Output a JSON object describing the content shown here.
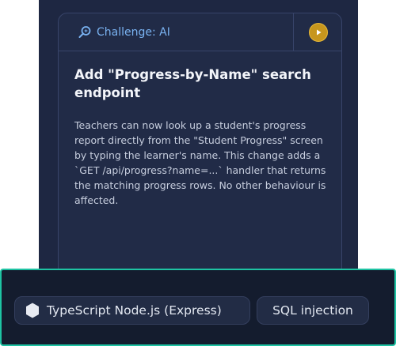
{
  "challenge": {
    "label": "Challenge: AI",
    "icon": "magnifier-sparkle-icon",
    "play_icon": "play-icon",
    "title": "Add \"Progress-by-Name\" search endpoint",
    "description": "Teachers can now look up a student's progress report directly from the \"Student Progress\" screen by typing the learner's name. This change adds a `GET /api/progress?name=...` handler that returns the matching progress rows. No other behaviour is affected."
  },
  "tags": {
    "language": "TypeScript Node.js (Express)",
    "language_icon": "hexagon-icon",
    "vulnerability": "SQL injection"
  },
  "colors": {
    "accent": "#7ab3f2",
    "play_button": "#c7961d",
    "highlight_border": "#1ec3a3",
    "panel": "#1e2742"
  }
}
